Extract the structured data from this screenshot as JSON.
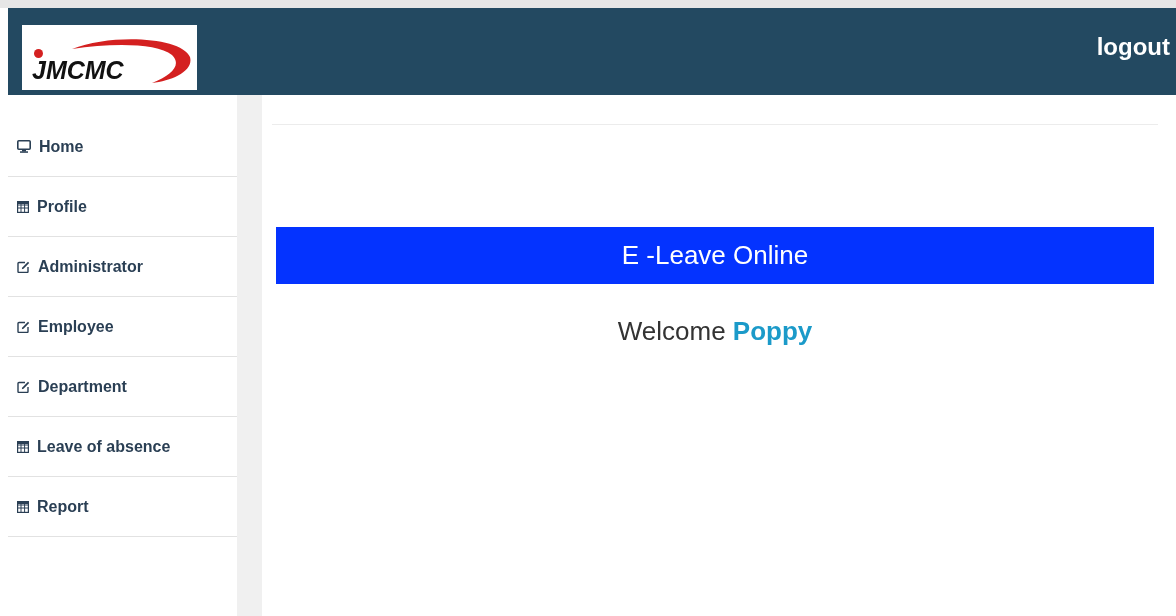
{
  "header": {
    "logo": "JMCMC",
    "logout": "logout"
  },
  "sidebar": {
    "items": [
      {
        "label": "Home",
        "kind": "monitor"
      },
      {
        "label": "Profile",
        "kind": "table"
      },
      {
        "label": "Administrator",
        "kind": "edit"
      },
      {
        "label": "Employee",
        "kind": "edit"
      },
      {
        "label": "Department",
        "kind": "edit"
      },
      {
        "label": "Leave of absence",
        "kind": "table"
      },
      {
        "label": "Report",
        "kind": "table"
      }
    ]
  },
  "main": {
    "banner": "E -Leave Online",
    "greeting": "Welcome",
    "user_name": "Poppy"
  }
}
